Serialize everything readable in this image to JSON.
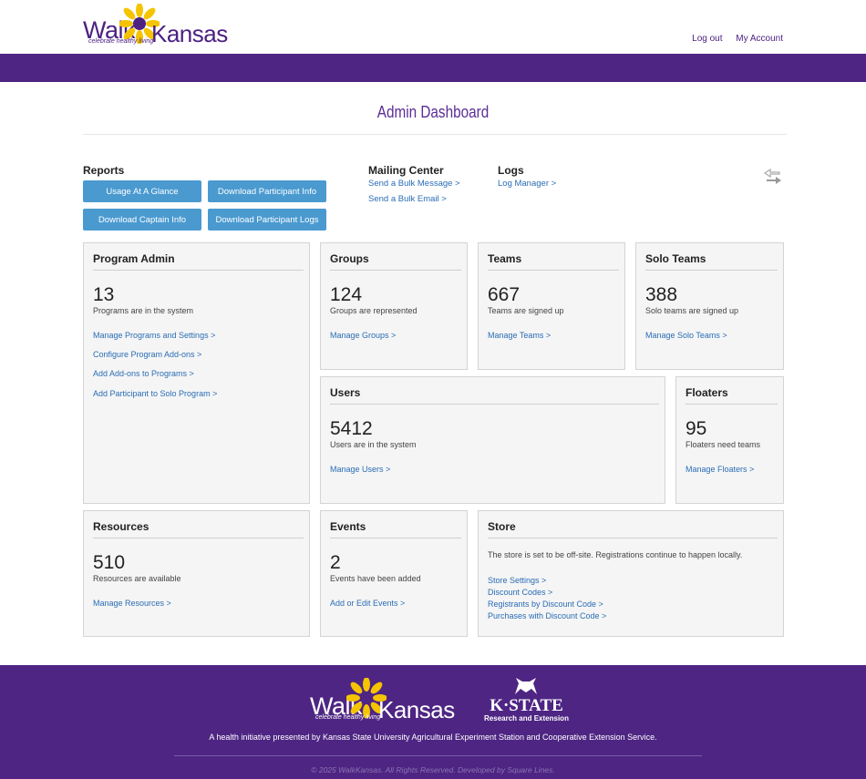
{
  "header": {
    "logo_walk": "Walk",
    "logo_kansas": "Kansas",
    "logo_tagline": "celebrate healthy living",
    "logout": "Log out",
    "my_account": "My Account"
  },
  "page_title": "Admin Dashboard",
  "reports": {
    "heading": "Reports",
    "buttons": [
      "Usage At A Glance",
      "Download Participant Info",
      "Download Captain Info",
      "Download Participant Logs"
    ]
  },
  "mailing": {
    "heading": "Mailing Center",
    "links": [
      "Send a Bulk Message >",
      "Send a Bulk Email >"
    ]
  },
  "logs": {
    "heading": "Logs",
    "links": [
      "Log Manager >"
    ]
  },
  "cards": {
    "program_admin": {
      "title": "Program Admin",
      "count": "13",
      "caption": "Programs are in the system",
      "links": [
        "Manage Programs and Settings >",
        "Configure Program Add-ons >",
        "Add Add-ons to Programs >",
        "Add Participant to Solo Program >"
      ]
    },
    "groups": {
      "title": "Groups",
      "count": "124",
      "caption": "Groups are represented",
      "link": "Manage Groups >"
    },
    "teams": {
      "title": "Teams",
      "count": "667",
      "caption": "Teams are signed up",
      "link": "Manage Teams >"
    },
    "solo_teams": {
      "title": "Solo Teams",
      "count": "388",
      "caption": "Solo teams are signed up",
      "link": "Manage Solo Teams >"
    },
    "users": {
      "title": "Users",
      "count": "5412",
      "caption": "Users are in the system",
      "link": "Manage Users >"
    },
    "floaters": {
      "title": "Floaters",
      "count": "95",
      "caption": "Floaters need teams",
      "link": "Manage Floaters >"
    },
    "resources": {
      "title": "Resources",
      "count": "510",
      "caption": "Resources are available",
      "link": "Manage Resources >"
    },
    "events": {
      "title": "Events",
      "count": "2",
      "caption": "Events have been added",
      "link": "Add or Edit Events >"
    },
    "store": {
      "title": "Store",
      "description": "The store is set to be off-site. Registrations continue to happen locally.",
      "links": [
        "Store Settings >",
        "Discount Codes >",
        "Registrants by Discount Code >",
        "Purchases with Discount Code >"
      ]
    }
  },
  "footer": {
    "logo_walk": "Walk",
    "logo_kansas": "Kansas",
    "logo_tagline": "celebrate healthy living",
    "kstate_name": "K·STATE",
    "kstate_sub": "Research and Extension",
    "text": "A health initiative presented by Kansas State University Agricultural Experiment Station and Cooperative Extension Service.",
    "copyright": "© 2025 WalkKansas. All Rights Reserved. Developed by Square Lines."
  },
  "colors": {
    "purple": "#4e2583",
    "button_blue": "#4a9ad0",
    "link_blue": "#2a6db5",
    "sunflower": "#f5c400"
  }
}
